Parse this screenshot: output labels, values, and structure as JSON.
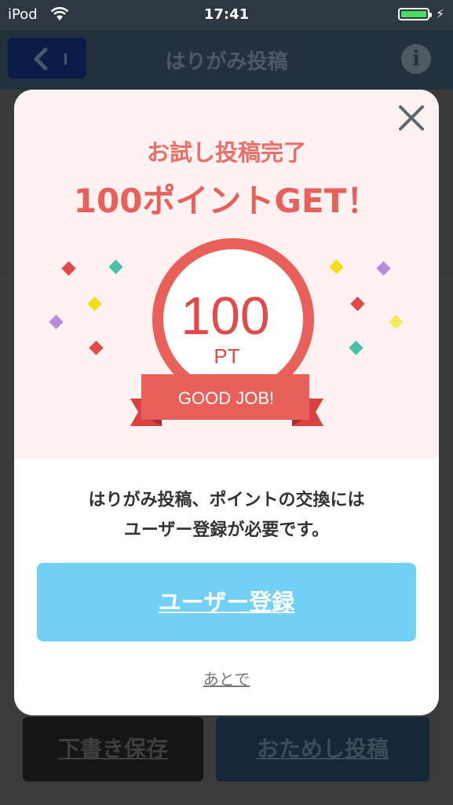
{
  "status_bar": {
    "carrier": "iPod",
    "time": "17:41"
  },
  "nav": {
    "title": "はりがみ投稿"
  },
  "footer": {
    "draft_label": "下書き保存",
    "trial_post_label": "おためし投稿"
  },
  "modal": {
    "heading": "お試し投稿完了",
    "subheading": "100ポイントGET！",
    "badge": {
      "value": "100",
      "unit": "PT",
      "ribbon": "GOOD JOB!"
    },
    "message_lines": [
      "はりがみ投稿、ポイントの交換には",
      "ユーザー登録が必要です。"
    ],
    "register_label": "ユーザー登録",
    "later_label": "あとで"
  },
  "colors": {
    "accent_red": "#e9605a",
    "register_blue": "#73d0f5",
    "modal_top_bg": "#fdf1f1"
  }
}
